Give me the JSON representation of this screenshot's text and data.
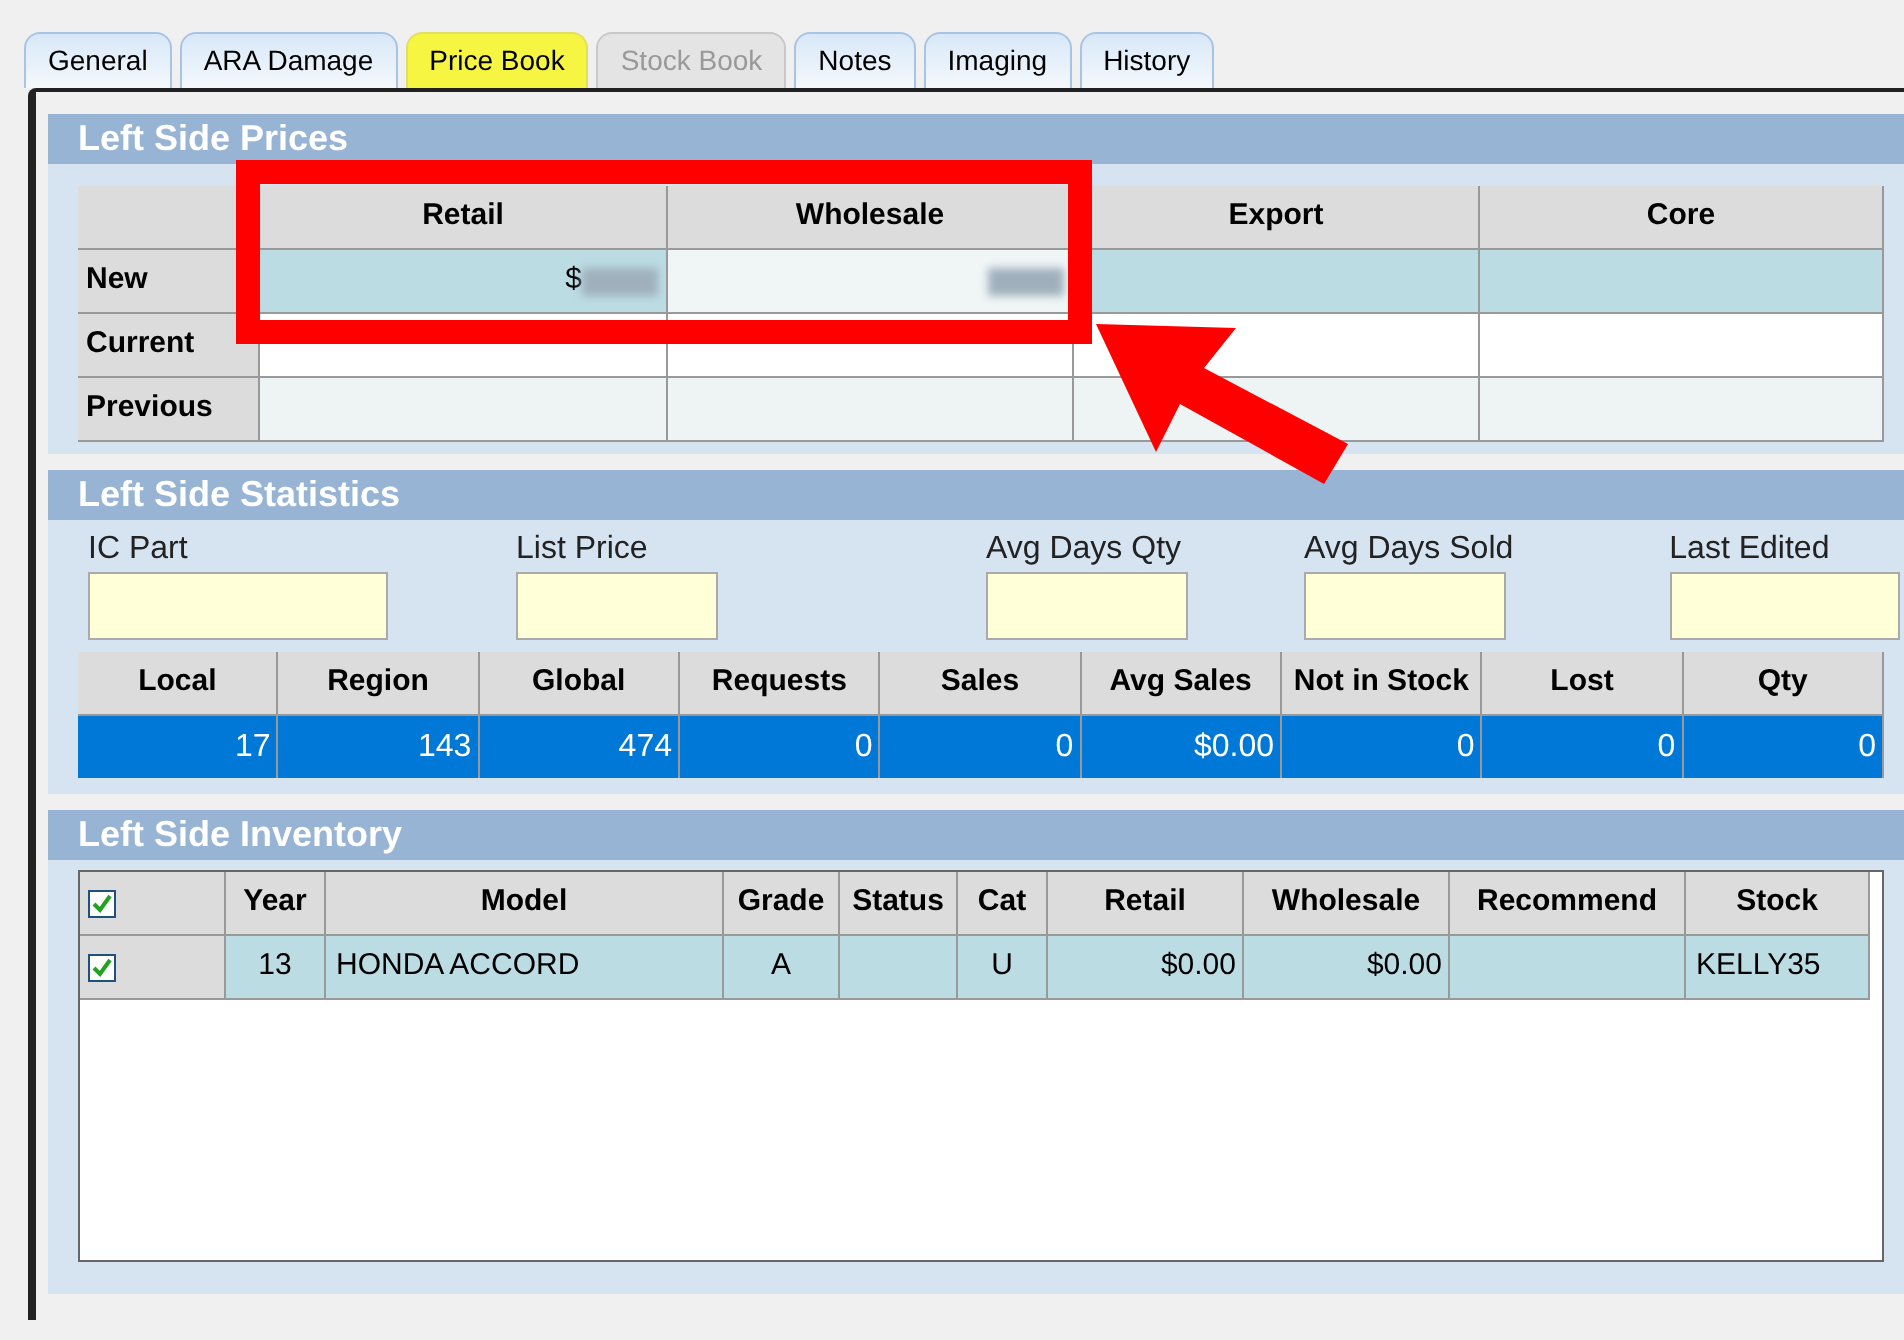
{
  "tabs": [
    {
      "label": "General",
      "selected": false,
      "disabled": false
    },
    {
      "label": "ARA Damage",
      "selected": false,
      "disabled": false
    },
    {
      "label": "Price Book",
      "selected": true,
      "disabled": false
    },
    {
      "label": "Stock Book",
      "selected": false,
      "disabled": true
    },
    {
      "label": "Notes",
      "selected": false,
      "disabled": false
    },
    {
      "label": "Imaging",
      "selected": false,
      "disabled": false
    },
    {
      "label": "History",
      "selected": false,
      "disabled": false
    }
  ],
  "prices": {
    "title": "Left Side Prices",
    "columns": [
      "Retail",
      "Wholesale",
      "Export",
      "Core"
    ],
    "rows": [
      {
        "label": "New",
        "cells": [
          "$",
          "",
          "",
          ""
        ],
        "blurred": [
          true,
          true,
          false,
          false
        ]
      },
      {
        "label": "Current",
        "cells": [
          "",
          "",
          "",
          ""
        ]
      },
      {
        "label": "Previous",
        "cells": [
          "",
          "",
          "",
          ""
        ]
      }
    ]
  },
  "statistics": {
    "title": "Left Side Statistics",
    "fields": [
      {
        "label": "IC Part"
      },
      {
        "label": "List Price"
      },
      {
        "label": "Avg Days Qty"
      },
      {
        "label": "Avg Days Sold"
      },
      {
        "label": "Last Edited"
      }
    ],
    "columns": [
      "Local",
      "Region",
      "Global",
      "Requests",
      "Sales",
      "Avg Sales",
      "Not in Stock",
      "Lost",
      "Qty"
    ],
    "rows": [
      {
        "selected": true,
        "cells": [
          "17",
          "143",
          "474",
          "0",
          "0",
          "$0.00",
          "0",
          "0",
          "0"
        ]
      }
    ]
  },
  "inventory": {
    "title": "Left Side Inventory",
    "all_checked": true,
    "columns": [
      "Year",
      "Model",
      "Grade",
      "Status",
      "Cat",
      "Retail",
      "Wholesale",
      "Recommend",
      "Stock"
    ],
    "rows": [
      {
        "checked": true,
        "cells": [
          "13",
          "HONDA ACCORD",
          "A",
          "",
          "U",
          "$0.00",
          "$0.00",
          "",
          "KELLY35"
        ]
      }
    ]
  }
}
